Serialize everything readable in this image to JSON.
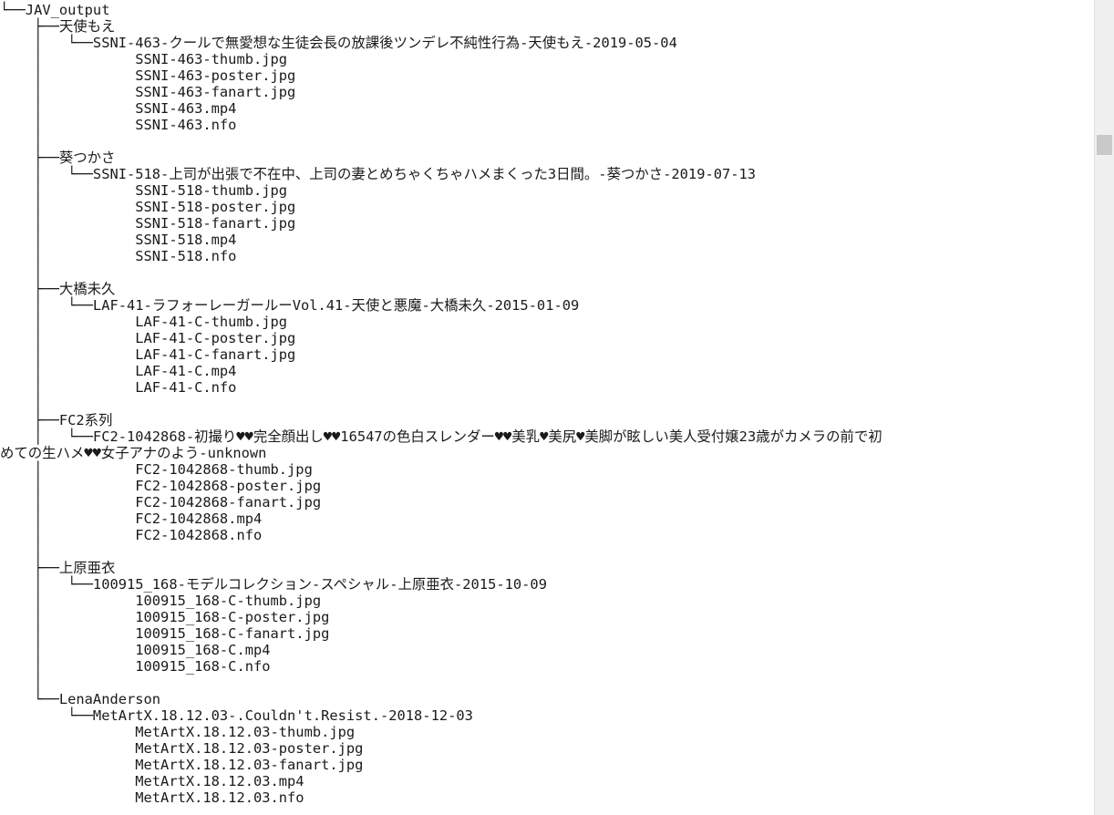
{
  "console": {
    "lines": [
      "└──JAV_output",
      "    ├──天使もえ",
      "    │   └──SSNI-463-クールで無愛想な生徒会長の放課後ツンデレ不純性行為-天使もえ-2019-05-04",
      "    │           SSNI-463-thumb.jpg",
      "    │           SSNI-463-poster.jpg",
      "    │           SSNI-463-fanart.jpg",
      "    │           SSNI-463.mp4",
      "    │           SSNI-463.nfo",
      "    │",
      "    ├──葵つかさ",
      "    │   └──SSNI-518-上司が出張で不在中、上司の妻とめちゃくちゃハメまくった3日間。-葵つかさ-2019-07-13",
      "    │           SSNI-518-thumb.jpg",
      "    │           SSNI-518-poster.jpg",
      "    │           SSNI-518-fanart.jpg",
      "    │           SSNI-518.mp4",
      "    │           SSNI-518.nfo",
      "    │",
      "    ├──大橋未久",
      "    │   └──LAF-41-ラフォーレーガールーVol.41-天使と悪魔-大橋未久-2015-01-09",
      "    │           LAF-41-C-thumb.jpg",
      "    │           LAF-41-C-poster.jpg",
      "    │           LAF-41-C-fanart.jpg",
      "    │           LAF-41-C.mp4",
      "    │           LAF-41-C.nfo",
      "    │",
      "    ├──FC2系列",
      "    │   └──FC2-1042868-初撮り♥♥完全顔出し♥♥16547の色白スレンダー♥♥美乳♥美尻♥美脚が眩しい美人受付嬢23歳がカメラの前で初",
      "めての生ハメ♥♥女子アナのよう-unknown",
      "    │           FC2-1042868-thumb.jpg",
      "    │           FC2-1042868-poster.jpg",
      "    │           FC2-1042868-fanart.jpg",
      "    │           FC2-1042868.mp4",
      "    │           FC2-1042868.nfo",
      "    │",
      "    ├──上原亜衣",
      "    │   └──100915_168-モデルコレクション-スペシャル-上原亜衣-2015-10-09",
      "    │           100915_168-C-thumb.jpg",
      "    │           100915_168-C-poster.jpg",
      "    │           100915_168-C-fanart.jpg",
      "    │           100915_168-C.mp4",
      "    │           100915_168-C.nfo",
      "    │",
      "    └──LenaAnderson",
      "        └──MetArtX.18.12.03-.Couldn't.Resist.-2018-12-03",
      "                MetArtX.18.12.03-thumb.jpg",
      "                MetArtX.18.12.03-poster.jpg",
      "                MetArtX.18.12.03-fanart.jpg",
      "                MetArtX.18.12.03.mp4",
      "                MetArtX.18.12.03.nfo"
    ]
  },
  "colors": {
    "background": "#ffffff",
    "text": "#1a1a1a",
    "scrollbar_track": "#f0f0f0",
    "scrollbar_thumb": "#c9c9c9"
  }
}
